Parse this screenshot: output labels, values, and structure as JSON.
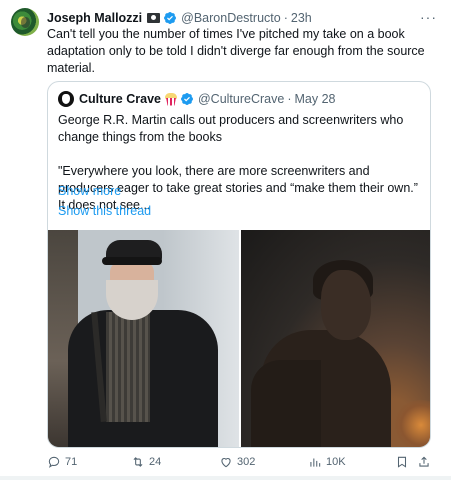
{
  "tweet": {
    "author_name": "Joseph Mallozzi",
    "handle": "@BaronDestructo",
    "separator": "·",
    "time": "23h",
    "more": "···",
    "text": "Can't tell you the number of times I've pitched my take on a book adaptation only to be told I didn't diverge far enough from the source material."
  },
  "quote": {
    "author_name": "Culture Crave",
    "handle": "@CultureCrave",
    "separator": "·",
    "date": "May 28",
    "line1": "George R.R. Martin calls out producers and screenwriters who change things from the books",
    "line2": "\"Everywhere you look, there are more screenwriters and producers eager to take great stories and “make them their own.” It does not see...",
    "show_more": "Show more",
    "show_thread": "Show this thread"
  },
  "actions": {
    "replies": "71",
    "reposts": "24",
    "likes": "302",
    "views": "10K"
  },
  "icons": {
    "verified": "verified-badge-icon",
    "reply": "reply-icon",
    "repost": "repost-icon",
    "like": "heart-icon",
    "views": "views-icon",
    "bookmark": "bookmark-icon",
    "share": "share-icon"
  },
  "colors": {
    "accent": "#1d9bf0",
    "muted": "#536471",
    "text": "#0f1419",
    "border": "#cfd9de"
  }
}
